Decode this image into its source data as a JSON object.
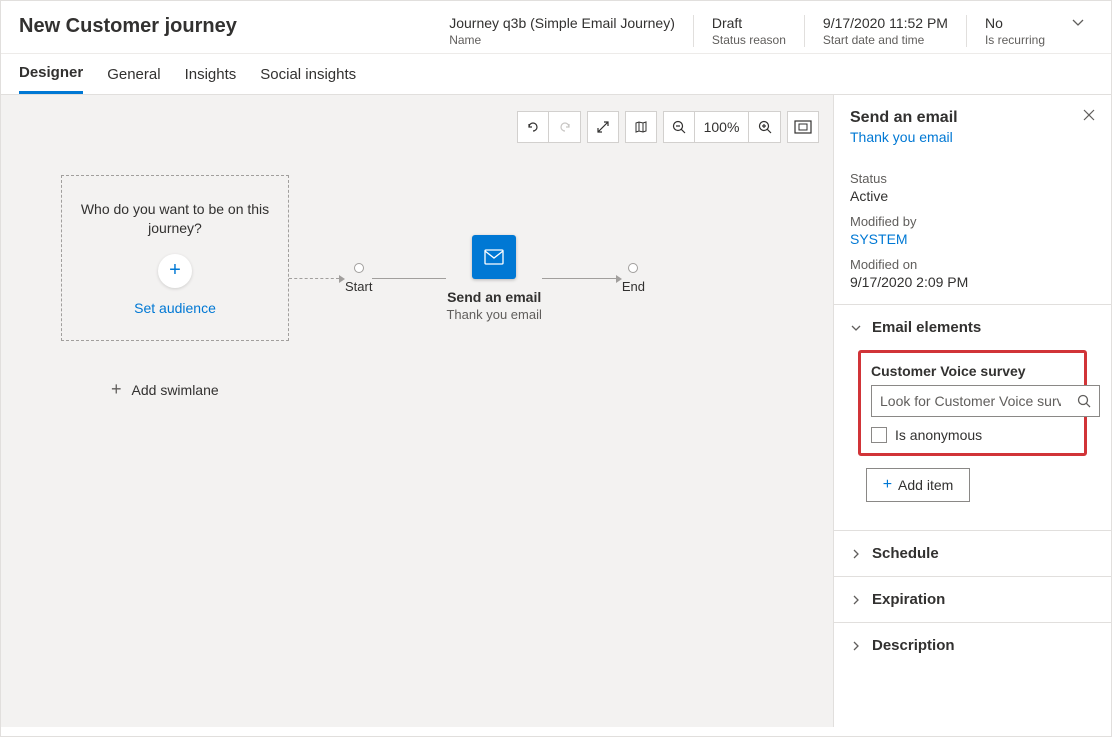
{
  "header": {
    "title": "New Customer journey",
    "fields": [
      {
        "value": "Journey q3b (Simple Email Journey)",
        "label": "Name"
      },
      {
        "value": "Draft",
        "label": "Status reason"
      },
      {
        "value": "9/17/2020 11:52 PM",
        "label": "Start date and time"
      },
      {
        "value": "No",
        "label": "Is recurring"
      }
    ]
  },
  "tabs": [
    "Designer",
    "General",
    "Insights",
    "Social insights"
  ],
  "toolbar": {
    "zoom": "100%"
  },
  "audience": {
    "prompt": "Who do you want to be on this journey?",
    "link": "Set audience"
  },
  "flow": {
    "start": "Start",
    "end": "End",
    "email_title": "Send an email",
    "email_sub": "Thank you email"
  },
  "add_swimlane": "Add swimlane",
  "panel": {
    "title": "Send an email",
    "link": "Thank you email",
    "status_label": "Status",
    "status_value": "Active",
    "modifiedby_label": "Modified by",
    "modifiedby_value": "SYSTEM",
    "modifiedon_label": "Modified on",
    "modifiedon_value": "9/17/2020 2:09 PM",
    "sections": {
      "elements": "Email elements",
      "schedule": "Schedule",
      "expiration": "Expiration",
      "description": "Description"
    },
    "survey": {
      "label": "Customer Voice survey",
      "placeholder": "Look for Customer Voice survey",
      "anon": "Is anonymous"
    },
    "add_item": "Add item"
  }
}
